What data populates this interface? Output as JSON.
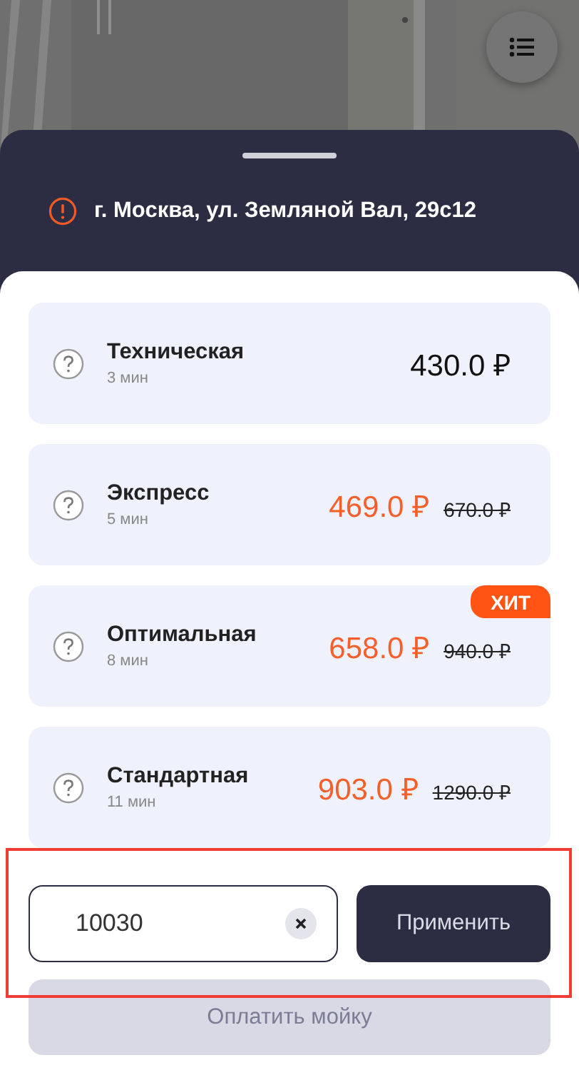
{
  "address": {
    "text": "г. Москва, ул. Земляной Вал, 29с12"
  },
  "tariffs": [
    {
      "name": "Техническая",
      "duration": "3 мин",
      "price": "430.0 ₽"
    },
    {
      "name": "Экспресс",
      "duration": "5 мин",
      "price": "469.0 ₽",
      "old_price": "670.0 ₽"
    },
    {
      "name": "Оптимальная",
      "duration": "8 мин",
      "price": "658.0 ₽",
      "old_price": "940.0 ₽",
      "badge": "ХИТ"
    },
    {
      "name": "Стандартная",
      "duration": "11 мин",
      "price": "903.0 ₽",
      "old_price": "1290.0 ₽"
    }
  ],
  "promo": {
    "value": "10030",
    "apply_button": "Применить",
    "highlighted": true
  },
  "pay_button": {
    "label": "Оплатить мойку",
    "disabled": true
  }
}
